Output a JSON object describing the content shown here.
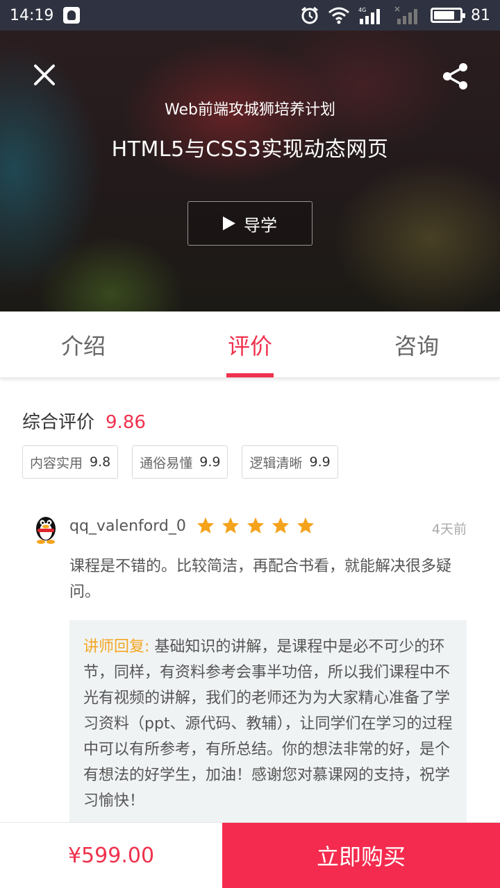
{
  "status_bar": {
    "time": "14:19",
    "network_label": "4G",
    "battery_level": 81,
    "battery_text": "81"
  },
  "hero": {
    "subtitle": "Web前端攻城狮培养计划",
    "title": "HTML5与CSS3实现动态网页",
    "guide_label": "导学",
    "icons": [
      "close-icon",
      "share-icon",
      "play-icon"
    ]
  },
  "tabs": [
    {
      "label": "介绍",
      "active": false
    },
    {
      "label": "评价",
      "active": true
    },
    {
      "label": "咨询",
      "active": false
    }
  ],
  "rating": {
    "label": "综合评价",
    "score": "9.86",
    "tags": [
      {
        "label": "内容实用",
        "value": "9.8"
      },
      {
        "label": "通俗易懂",
        "value": "9.9"
      },
      {
        "label": "逻辑清晰",
        "value": "9.9"
      }
    ]
  },
  "review": {
    "username": "qq_valenford_0",
    "stars": 5,
    "time": "4天前",
    "text": "课程是不错的。比较简洁，再配合书看，就能解决很多疑问。",
    "reply_label": "讲师回复:",
    "reply_text": " 基础知识的讲解，是课程中是必不可少的环节，同样，有资料参考会事半功倍，所以我们课程中不光有视频的讲解，我们的老师还为为大家精心准备了学习资料（ppt、源代码、教辅），让同学们在学习的过程中可以有所参考，有所总结。你的想法非常的好，是个有想法的好学生，加油！感谢您对慕课网的支持，祝学习愉快！"
  },
  "bottom_bar": {
    "price": "¥599.00",
    "buy_label": "立即购买"
  },
  "colors": {
    "accent": "#f0314d",
    "buy_button": "#f42b4e",
    "star": "#f5a31c",
    "reply_label": "#f5a623",
    "status_bar": "#2f3240"
  }
}
